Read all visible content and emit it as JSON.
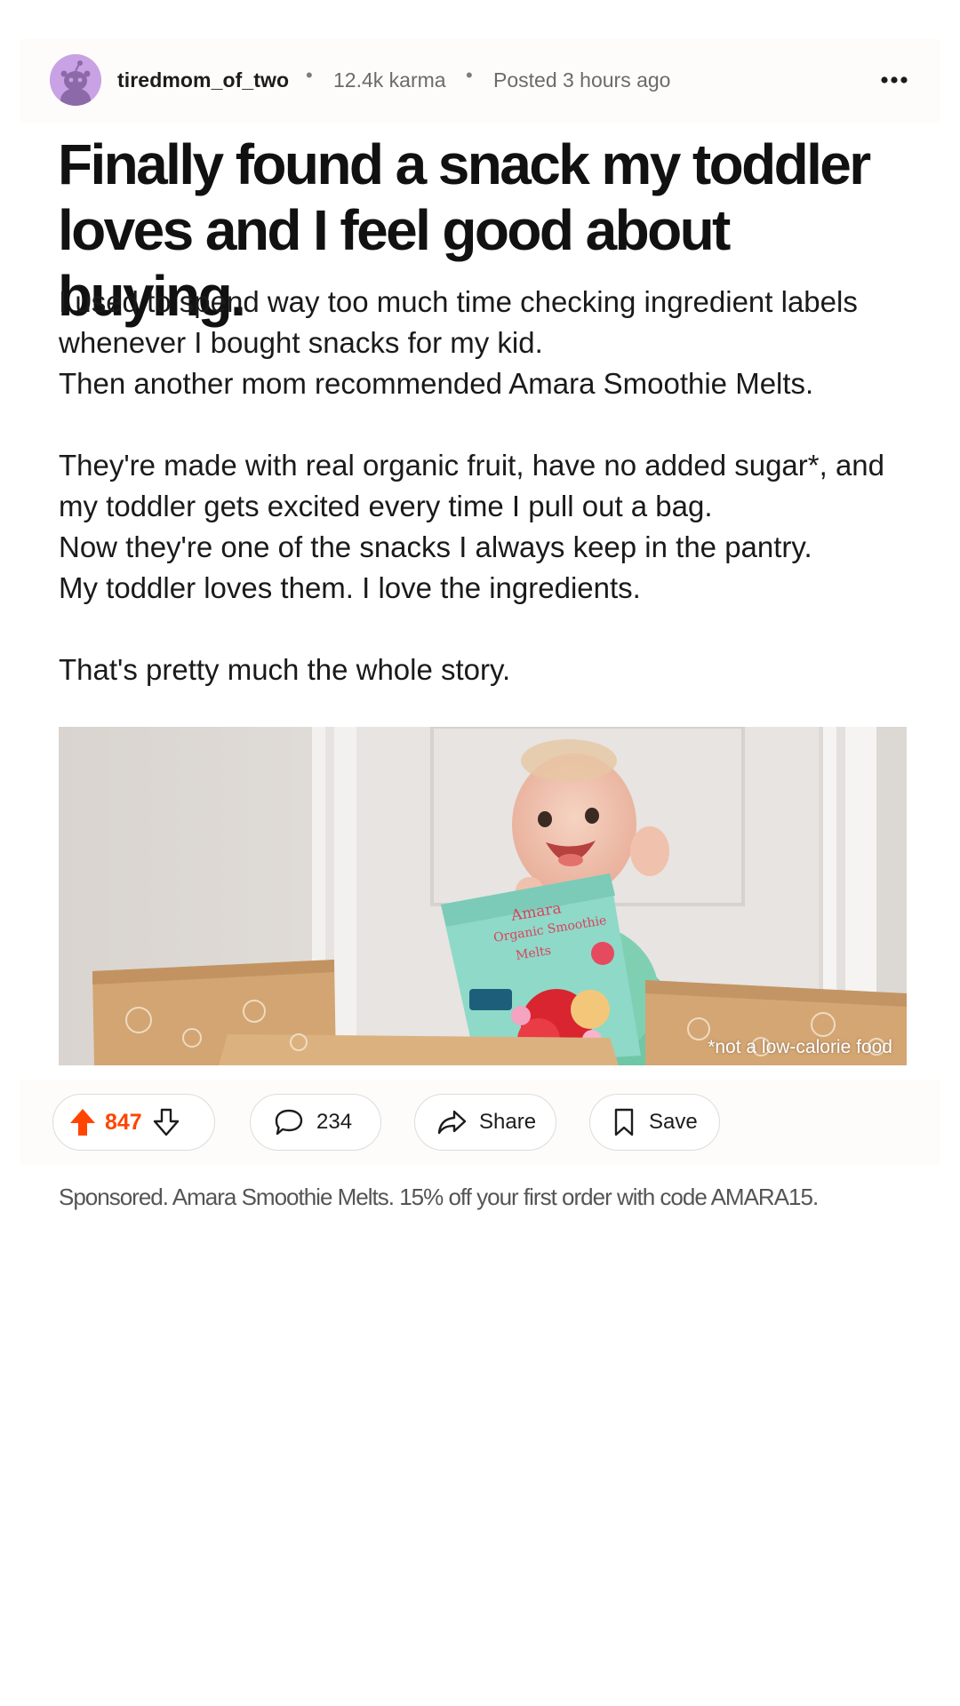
{
  "post": {
    "author": "tiredmom_of_two",
    "separator": "•",
    "karma": "12.4k karma",
    "posted": "Posted 3 hours ago",
    "title_lines": [
      "Finally found a snack my toddler",
      "loves and I feel good about buying."
    ],
    "body": {
      "para1": [
        "I used to spend way too much time checking ingredient labels",
        "whenever I bought snacks for my kid.",
        "Then another mom recommended Amara Smoothie Melts."
      ],
      "para2": [
        "They're made with real organic fruit, have no added sugar*, and",
        "my toddler gets excited every time I pull out a bag.",
        "Now they're one of the snacks I always keep in the pantry.",
        "My toddler loves them. I love the ingredients."
      ],
      "para3": [
        "That's pretty much the whole story."
      ]
    },
    "image": {
      "caption": "*not a low-calorie food",
      "package": {
        "brand": "Amara",
        "line1": "Organic Smoothie",
        "line2": "Melts"
      }
    }
  },
  "actions": {
    "upvotes": "847",
    "comments": "234",
    "share_label": "Share",
    "save_label": "Save"
  },
  "sponsored": "Sponsored. Amara Smoothie Melts. 15% off your first order with code AMARA15.",
  "icons": {
    "upvote": "arrow-up-filled-icon",
    "downvote": "arrow-down-outline-icon",
    "comment": "speech-bubble-icon",
    "share": "share-arrow-icon",
    "save": "bookmark-icon",
    "more": "more-horizontal-icon"
  },
  "colors": {
    "upvote_active": "#ff4500",
    "avatar_bg": "#c9a2e6",
    "text_primary": "#111111",
    "text_muted": "#6b6b6b",
    "pill_border": "#dcdcdc"
  }
}
